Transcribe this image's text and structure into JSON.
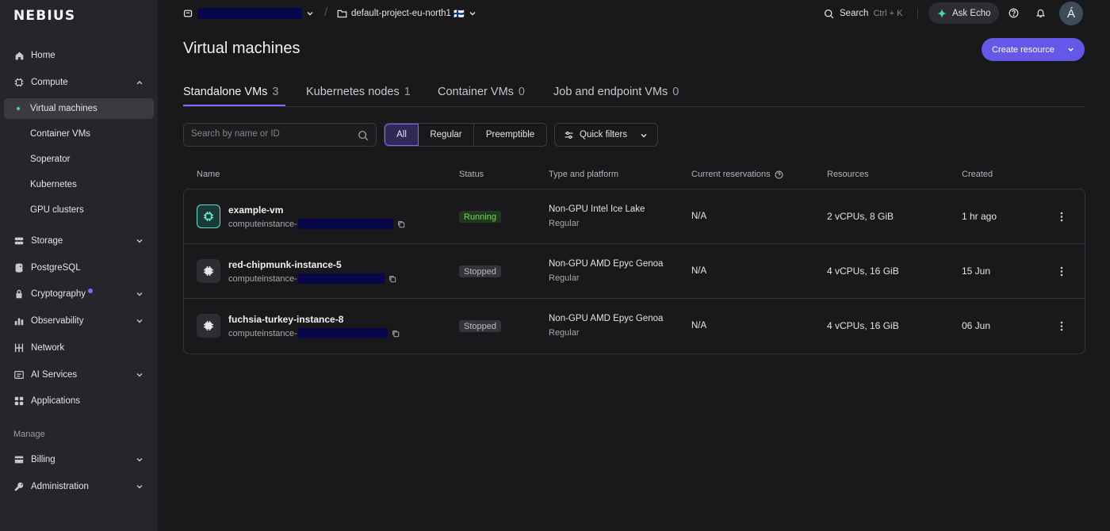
{
  "brand": {
    "logo_text": "NEBIUS"
  },
  "sidebar": {
    "items": [
      {
        "label": "Home",
        "icon": "home-icon"
      },
      {
        "label": "Compute",
        "icon": "chip-icon",
        "expanded": true
      },
      {
        "label": "Virtual machines",
        "sub": true,
        "active": true
      },
      {
        "label": "Container VMs",
        "sub": true
      },
      {
        "label": "Soperator",
        "sub": true
      },
      {
        "label": "Kubernetes",
        "sub": true
      },
      {
        "label": "GPU clusters",
        "sub": true
      },
      {
        "label": "Storage",
        "icon": "storage-icon"
      },
      {
        "label": "PostgreSQL",
        "icon": "database-icon"
      },
      {
        "label": "Cryptography",
        "icon": "lock-icon",
        "has_badge": true
      },
      {
        "label": "Observability",
        "icon": "chart-icon"
      },
      {
        "label": "Network",
        "icon": "network-icon"
      },
      {
        "label": "AI Services",
        "icon": "ai-icon"
      },
      {
        "label": "Applications",
        "icon": "apps-icon"
      }
    ],
    "manage_label": "Manage",
    "manage_items": [
      {
        "label": "Billing",
        "icon": "billing-icon"
      },
      {
        "label": "Administration",
        "icon": "admin-icon"
      }
    ]
  },
  "topbar": {
    "project": "default-project-eu-north1",
    "region_flag": "🇫🇮",
    "search_label": "Search",
    "search_shortcut": "Ctrl + K",
    "ask_label": "Ask Echo",
    "avatar_initial": "Á"
  },
  "page": {
    "title": "Virtual machines",
    "create_label": "Create resource"
  },
  "tabs": [
    {
      "label": "Standalone VMs",
      "count": "3",
      "active": true
    },
    {
      "label": "Kubernetes nodes",
      "count": "1"
    },
    {
      "label": "Container VMs",
      "count": "0"
    },
    {
      "label": "Job and endpoint VMs",
      "count": "0"
    }
  ],
  "filters": {
    "search_placeholder": "Search by name or ID",
    "options": [
      "All",
      "Regular",
      "Preemptible"
    ],
    "selected": "All",
    "quick_label": "Quick filters"
  },
  "table": {
    "columns": [
      "Name",
      "Status",
      "Type and platform",
      "Current reservations",
      "Resources",
      "Created"
    ],
    "rows": [
      {
        "name": "example-vm",
        "id_prefix": "computeinstance-",
        "status": "Running",
        "platform": "Non-GPU Intel Ice Lake",
        "preemption": "Regular",
        "reservations": "N/A",
        "resources": "2 vCPUs, 8 GiB",
        "created": "1 hr ago"
      },
      {
        "name": "red-chipmunk-instance-5",
        "id_prefix": "computeinstance-",
        "status": "Stopped",
        "platform": "Non-GPU AMD Epyc Genoa",
        "preemption": "Regular",
        "reservations": "N/A",
        "resources": "4 vCPUs, 16 GiB",
        "created": "15 Jun"
      },
      {
        "name": "fuchsia-turkey-instance-8",
        "id_prefix": "computeinstance-",
        "status": "Stopped",
        "platform": "Non-GPU AMD Epyc Genoa",
        "preemption": "Regular",
        "reservations": "N/A",
        "resources": "4 vCPUs, 16 GiB",
        "created": "06 Jun"
      }
    ]
  },
  "colors": {
    "accent": "#6557e8",
    "teal": "#3fd8b6",
    "running": "#75d25e",
    "redacted": "#07074a"
  }
}
